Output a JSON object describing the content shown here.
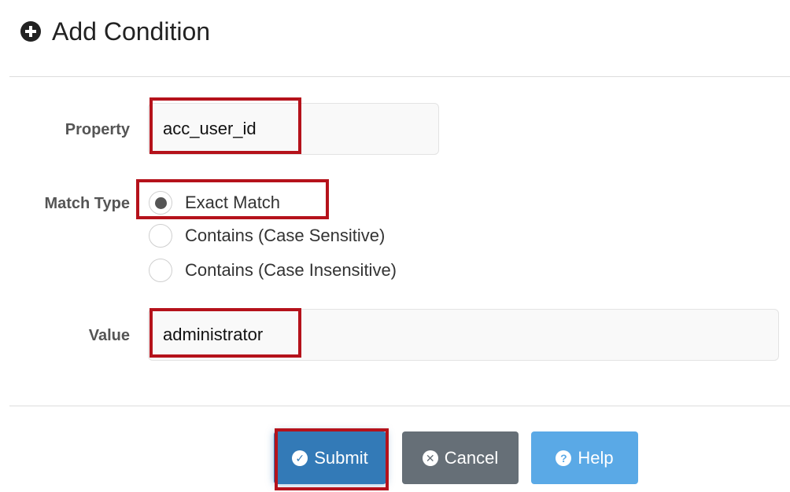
{
  "header": {
    "title": "Add Condition",
    "icon": "plus-circle-icon"
  },
  "form": {
    "property": {
      "label": "Property",
      "value": "acc_user_id"
    },
    "match_type": {
      "label": "Match Type",
      "options": [
        {
          "label": "Exact Match",
          "selected": true
        },
        {
          "label": "Contains (Case Sensitive)",
          "selected": false
        },
        {
          "label": "Contains (Case Insensitive)",
          "selected": false
        }
      ]
    },
    "value": {
      "label": "Value",
      "value": "administrator"
    }
  },
  "buttons": {
    "submit": {
      "label": "Submit",
      "icon": "check-circle-icon",
      "color": "#337ab7"
    },
    "cancel": {
      "label": "Cancel",
      "icon": "times-circle-icon",
      "color": "#666f77"
    },
    "help": {
      "label": "Help",
      "icon": "question-circle-icon",
      "color": "#5aa9e6"
    }
  },
  "highlight_color": "#b5121b"
}
